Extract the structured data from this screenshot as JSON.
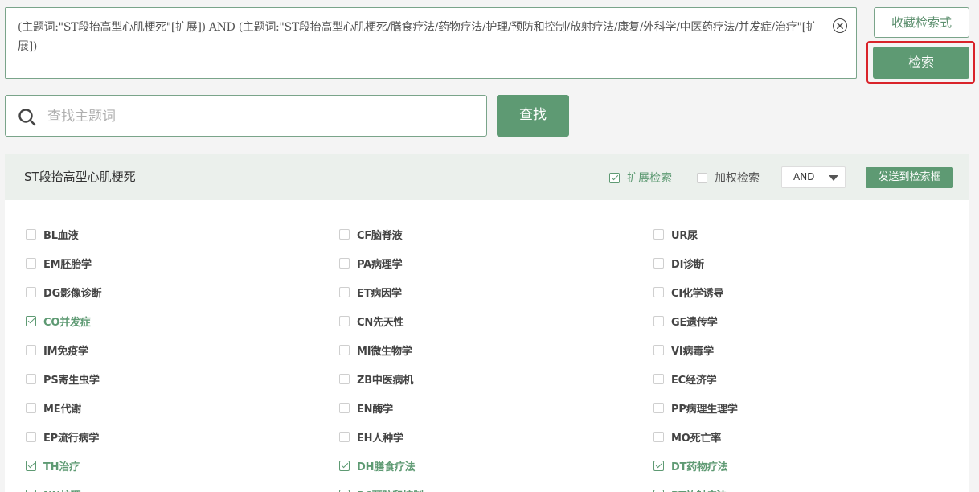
{
  "query": {
    "text": "(主题词:\"ST段抬高型心肌梗死\"[扩展]) AND (主题词:\"ST段抬高型心肌梗死/膳食疗法/药物疗法/护理/预防和控制/放射疗法/康复/外科学/中医药疗法/并发症/治疗\"[扩展])"
  },
  "buttons": {
    "save": "收藏检索式",
    "search": "检索",
    "find": "查找",
    "send": "发送到检索框"
  },
  "find_input": {
    "placeholder": "查找主题词",
    "value": ""
  },
  "panel": {
    "title": "ST段抬高型心肌梗死",
    "expand_label": "扩展检索",
    "expand_checked": true,
    "weight_label": "加权检索",
    "weight_checked": false,
    "logic_value": "AND"
  },
  "subheadings": [
    [
      {
        "label": "BL血液",
        "checked": false
      },
      {
        "label": "EM胚胎学",
        "checked": false
      },
      {
        "label": "DG影像诊断",
        "checked": false
      },
      {
        "label": "CO并发症",
        "checked": true
      },
      {
        "label": "IM免疫学",
        "checked": false
      },
      {
        "label": "PS寄生虫学",
        "checked": false
      },
      {
        "label": "ME代谢",
        "checked": false
      },
      {
        "label": "EP流行病学",
        "checked": false
      },
      {
        "label": "TH治疗",
        "checked": true
      },
      {
        "label": "NU护理",
        "checked": true
      }
    ],
    [
      {
        "label": "CF脑脊液",
        "checked": false
      },
      {
        "label": "PA病理学",
        "checked": false
      },
      {
        "label": "ET病因学",
        "checked": false
      },
      {
        "label": "CN先天性",
        "checked": false
      },
      {
        "label": "MI微生物学",
        "checked": false
      },
      {
        "label": "ZB中医病机",
        "checked": false
      },
      {
        "label": "EN酶学",
        "checked": false
      },
      {
        "label": "EH人种学",
        "checked": false
      },
      {
        "label": "DH膳食疗法",
        "checked": true
      },
      {
        "label": "PC预防和控制",
        "checked": true
      }
    ],
    [
      {
        "label": "UR尿",
        "checked": false
      },
      {
        "label": "DI诊断",
        "checked": false
      },
      {
        "label": "CI化学诱导",
        "checked": false
      },
      {
        "label": "GE遗传学",
        "checked": false
      },
      {
        "label": "VI病毒学",
        "checked": false
      },
      {
        "label": "EC经济学",
        "checked": false
      },
      {
        "label": "PP病理生理学",
        "checked": false
      },
      {
        "label": "MO死亡率",
        "checked": false
      },
      {
        "label": "DT药物疗法",
        "checked": true
      },
      {
        "label": "RT放射疗法",
        "checked": true
      }
    ]
  ]
}
